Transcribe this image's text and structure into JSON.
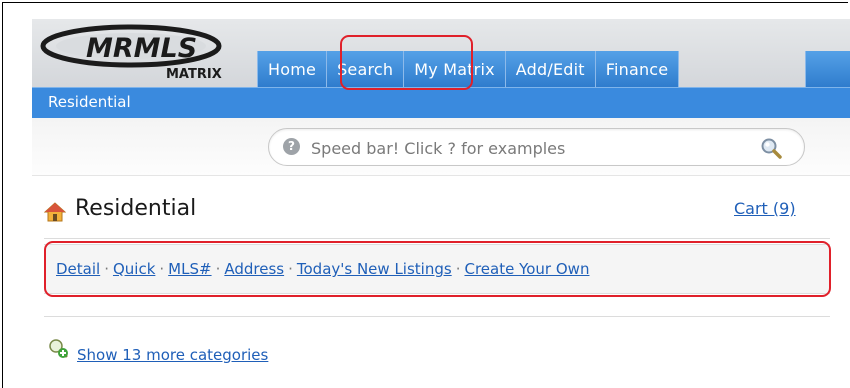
{
  "app": {
    "logo_text_top": "MRMLS",
    "logo_text_bottom": "MATRIX"
  },
  "nav": {
    "tabs": [
      {
        "label": "Home"
      },
      {
        "label": "Search"
      },
      {
        "label": "My Matrix"
      },
      {
        "label": "Add/Edit"
      },
      {
        "label": "Finance"
      }
    ],
    "active_subnav": "Residential"
  },
  "speedbar": {
    "placeholder": "Speed bar! Click ? for examples",
    "help_symbol": "?",
    "search_icon": "magnifier-icon"
  },
  "page": {
    "title": "Residential",
    "cart_label": "Cart (9)"
  },
  "search_links": [
    {
      "label": "Detail"
    },
    {
      "label": "Quick"
    },
    {
      "label": "MLS#"
    },
    {
      "label": "Address"
    },
    {
      "label": "Today's New Listings"
    },
    {
      "label": "Create Your Own"
    }
  ],
  "separator": "·",
  "more_categories": "Show 13 more categories",
  "colors": {
    "tab_blue": "#3b86d4",
    "subnav_blue": "#3a8ade",
    "link_blue": "#1f5fb8",
    "highlight_red": "#e0202a"
  }
}
